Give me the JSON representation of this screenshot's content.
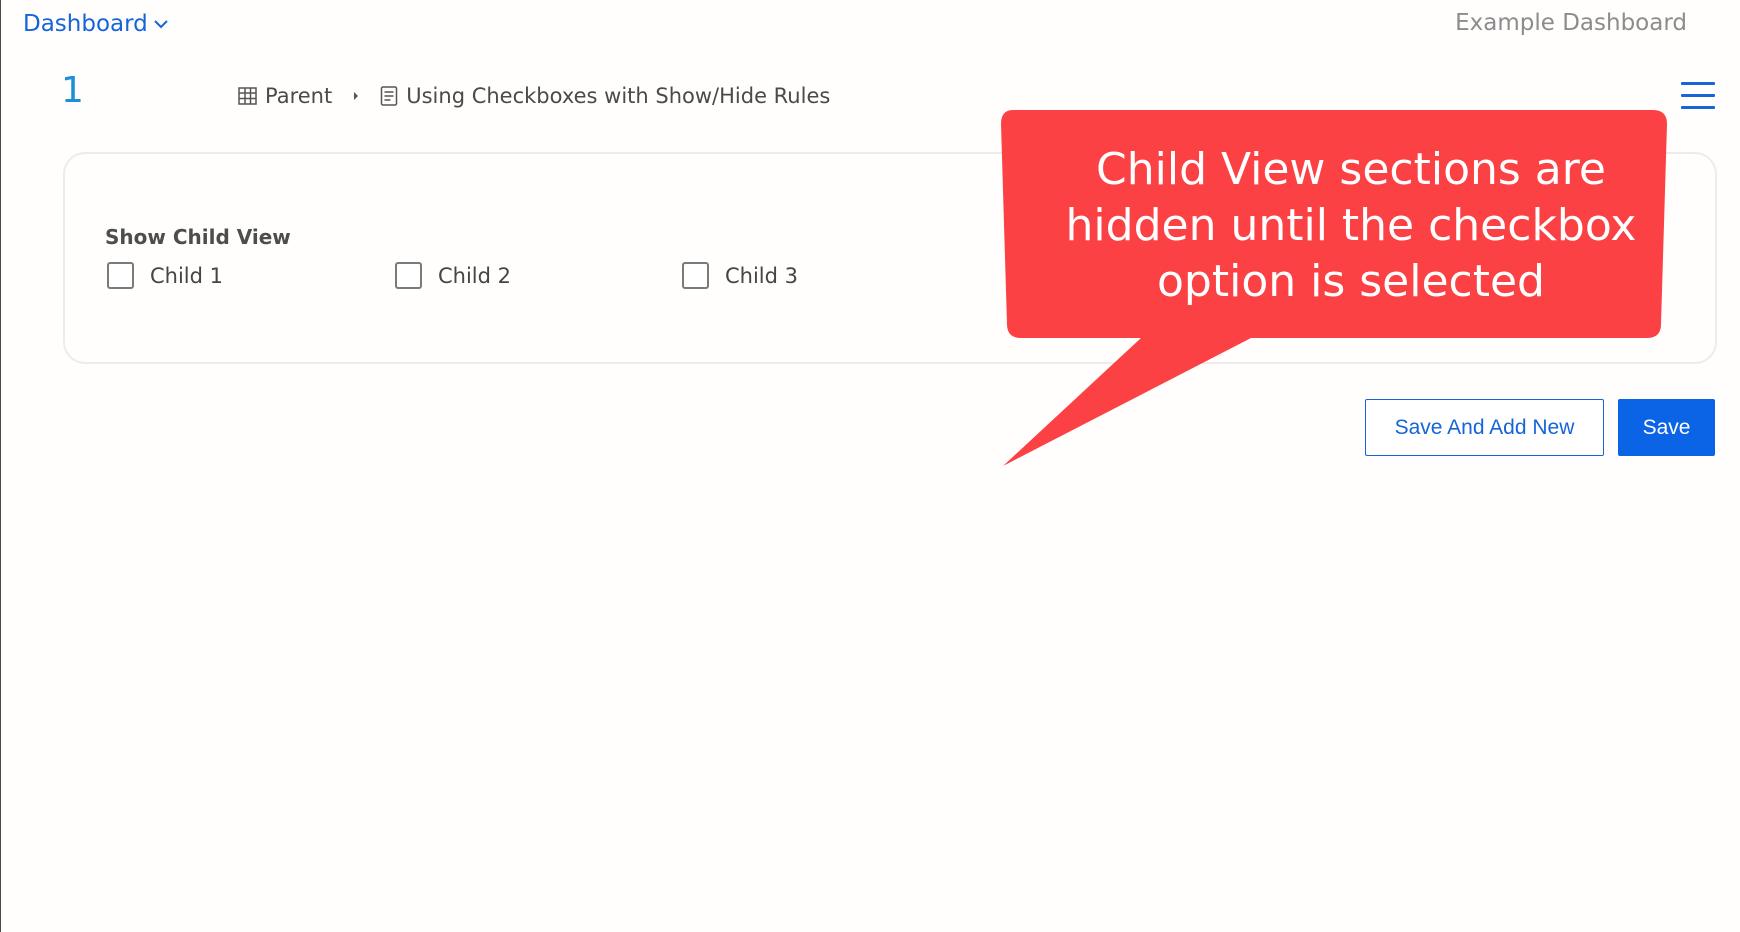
{
  "topbar": {
    "dashboard_label": "Dashboard",
    "app_title": "Example Dashboard"
  },
  "record": {
    "number": "1"
  },
  "breadcrumb": {
    "items": [
      {
        "label": "Parent",
        "icon": "table-icon"
      },
      {
        "label": "Using Checkboxes with Show/Hide Rules",
        "icon": "document-icon"
      }
    ]
  },
  "form": {
    "group_label": "Show Child View",
    "options": [
      {
        "label": "Child 1",
        "checked": false
      },
      {
        "label": "Child 2",
        "checked": false
      },
      {
        "label": "Child 3",
        "checked": false
      }
    ]
  },
  "actions": {
    "save_and_add_new": "Save And Add New",
    "save": "Save"
  },
  "callout": {
    "lines": [
      "Child View sections are",
      "hidden until the checkbox",
      "option is selected"
    ],
    "color": "#fb4144"
  },
  "colors": {
    "accent": "#1565d8",
    "primary_button": "#0b63e5",
    "record_number": "#1d8fd6"
  }
}
